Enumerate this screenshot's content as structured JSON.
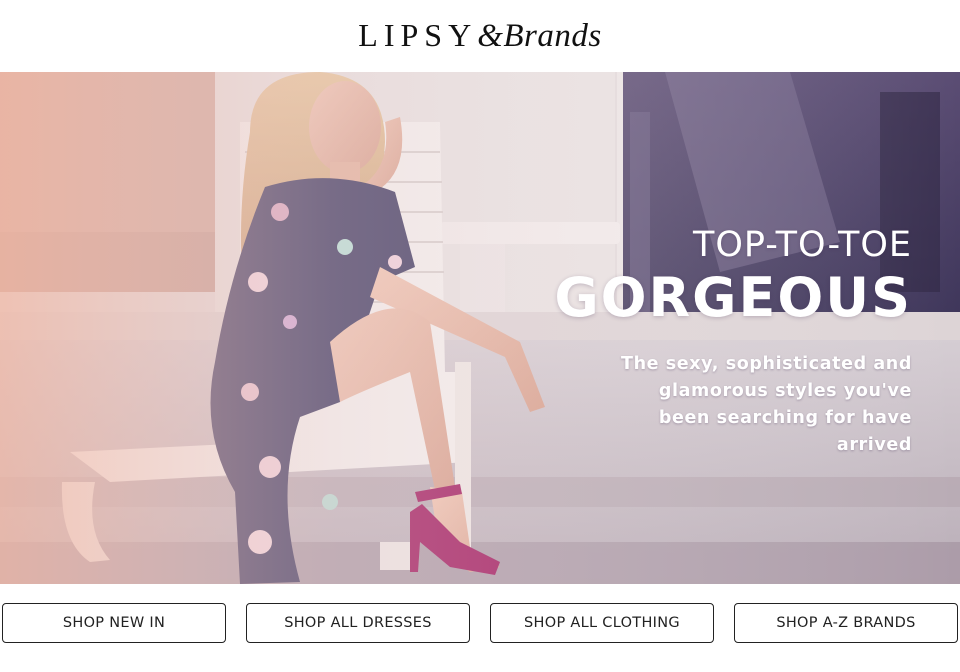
{
  "header": {
    "logo_main": "LIPSY",
    "logo_sub": "&Brands"
  },
  "hero": {
    "kicker": "TOP-TO-TOE",
    "title": "GORGEOUS",
    "copy": "The sexy, sophisticated and glamorous styles you've been searching for have arrived"
  },
  "buttons": [
    {
      "label": "SHOP NEW IN"
    },
    {
      "label": "SHOP ALL DRESSES"
    },
    {
      "label": "SHOP ALL CLOTHING"
    },
    {
      "label": "SHOP A-Z BRANDS"
    }
  ],
  "colors": {
    "text": "#111111",
    "button_border": "#222222",
    "hero_text": "#ffffff",
    "dress": "#3a3660",
    "shoes": "#a0175e"
  }
}
